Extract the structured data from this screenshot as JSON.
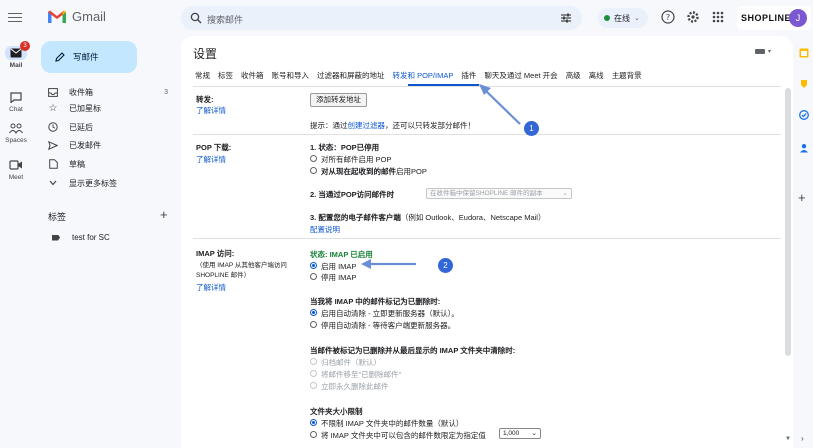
{
  "app": {
    "name": "Gmail",
    "search_placeholder": "搜索邮件",
    "status": "在线",
    "brand": "SHOPLINE",
    "avatar_letter": "J",
    "colors": {
      "accent": "#0b57d0",
      "compose": "#c2e7ff",
      "badge": "#d93025",
      "status": "#1e8e3e"
    }
  },
  "rail": {
    "items": [
      {
        "label": "Mail",
        "icon": "mail-icon",
        "badge": "3"
      },
      {
        "label": "Chat",
        "icon": "chat-icon"
      },
      {
        "label": "Spaces",
        "icon": "spaces-icon"
      },
      {
        "label": "Meet",
        "icon": "meet-icon"
      }
    ]
  },
  "nav": {
    "compose": "写邮件",
    "items": [
      {
        "label": "收件箱",
        "count": "3",
        "icon": "inbox-icon"
      },
      {
        "label": "已加星标",
        "icon": "star-icon"
      },
      {
        "label": "已延后",
        "icon": "clock-icon"
      },
      {
        "label": "已发邮件",
        "icon": "send-icon"
      },
      {
        "label": "草稿",
        "icon": "draft-icon"
      },
      {
        "label": "显示更多标签",
        "icon": "chevron-down-icon"
      }
    ],
    "labels_heading": "标签",
    "labels": [
      {
        "label": "test for SC"
      }
    ]
  },
  "settings": {
    "title": "设置",
    "tabs": [
      "常规",
      "标签",
      "收件箱",
      "账号和导入",
      "过滤器和屏蔽的地址",
      "转发和 POP/IMAP",
      "插件",
      "聊天及通过 Meet 开会",
      "高级",
      "离线",
      "主题背景"
    ],
    "active_tab": "转发和 POP/IMAP",
    "forwarding": {
      "label": "转发:",
      "learn_more": "了解详情",
      "add_button": "添加转发地址",
      "tip_prefix": "提示：通过",
      "tip_link": "创建过滤器",
      "tip_suffix": "，还可以只转发部分邮件！"
    },
    "pop": {
      "label": "POP 下载:",
      "learn_more": "了解详情",
      "status_heading": "1. 状态：",
      "status_value": "POP已停用",
      "option_all": "对所有邮件启用 POP",
      "option_from_now_bold": "对从现在起收到的邮件",
      "option_from_now_rest": "启用POP",
      "step2": "2. 当通过POP访问邮件时",
      "step2_select": "在收件箱中保留SHOPLINE 邮件的副本",
      "step3_bold": "3. 配置您的电子邮件客户端",
      "step3_rest": "（例如 Outlook、Eudora、Netscape Mail）",
      "config_link": "配置说明"
    },
    "imap": {
      "label": "IMAP 访问:",
      "note_line1": "（使用 IMAP 从其他客户端访问",
      "note_line2": "SHOPLINE 邮件）",
      "learn_more": "了解详情",
      "status": "状态: IMAP 已启用",
      "enable": "启用 IMAP",
      "disable": "停用 IMAP",
      "deleted_heading": "当我将 IMAP 中的邮件标记为已删除时:",
      "auto_expunge_on": "启用自动清除 - 立即更新服务器（默认）。",
      "auto_expunge_off": "停用自动清除 - 等待客户端更新服务器。",
      "expunge_heading": "当邮件被标记为已删除并从最后显示的 IMAP 文件夹中清除时:",
      "archive": "归档邮件（默认）",
      "trash": "将邮件移至\"已删除邮件\"",
      "delete_forever": "立即永久删除此邮件",
      "folder_heading": "文件夹大小限制",
      "no_limit": "不限制 IMAP 文件夹中的邮件数量（默认）",
      "limit": "将 IMAP 文件夹中可以包含的邮件数限定为指定值",
      "limit_value": "1,000"
    },
    "annotations": [
      "1",
      "2"
    ]
  }
}
